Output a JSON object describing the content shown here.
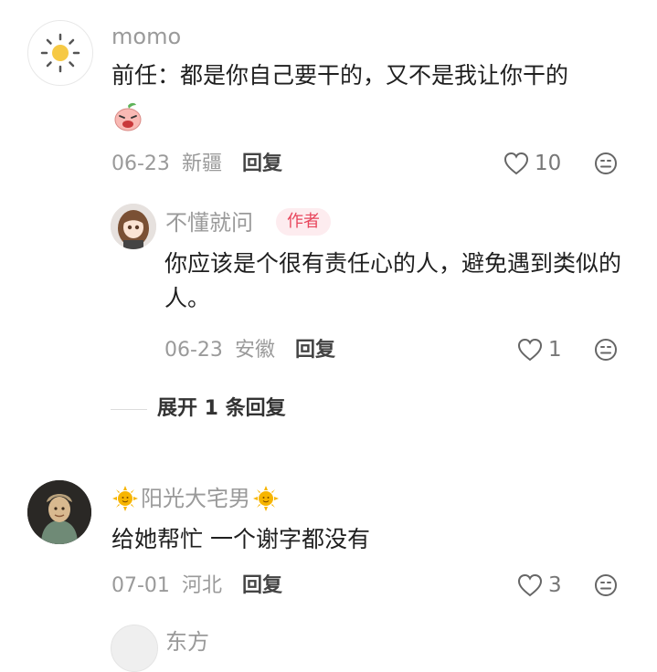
{
  "comments": [
    {
      "author": "momo",
      "text": "前任：都是你自己要干的，又不是我让你干的",
      "date": "06-23",
      "location": "新疆",
      "reply_label": "回复",
      "likes": "10",
      "emoji_sticker": "angry-peach-sticker",
      "replies": [
        {
          "author": "不懂就问",
          "badge": "作者",
          "text": "你应该是个很有责任心的人，避免遇到类似的人。",
          "date": "06-23",
          "location": "安徽",
          "reply_label": "回复",
          "likes": "1"
        }
      ],
      "expand_label": "展开 1 条回复"
    },
    {
      "author": "阳光大宅男",
      "name_decoration": "sun-emoji",
      "text": "给她帮忙 一个谢字都没有",
      "date": "07-01",
      "location": "河北",
      "reply_label": "回复",
      "likes": "3"
    }
  ],
  "partial_next_author": "东方"
}
